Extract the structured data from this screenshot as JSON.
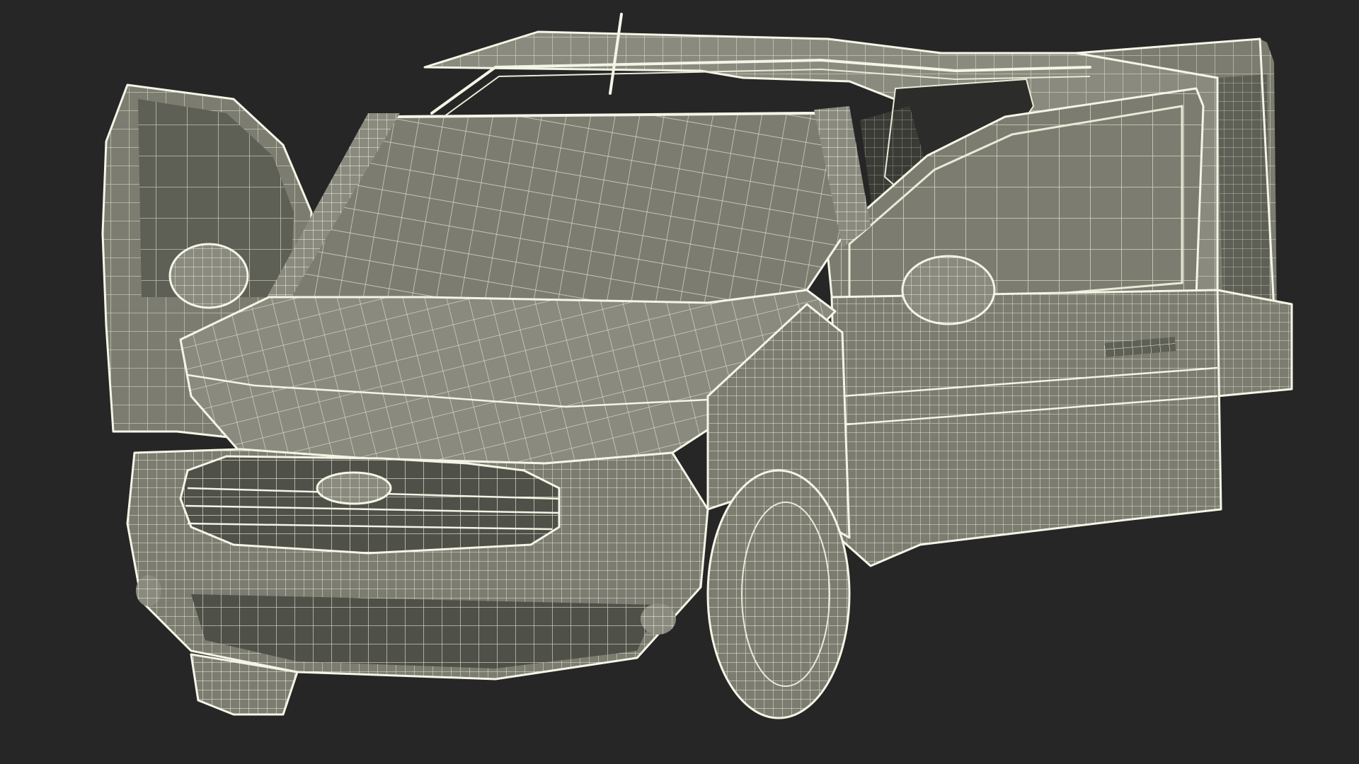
{
  "scene": {
    "subject_icon": "wireframe-van-icon",
    "background_color": "#262626",
    "surface_color": "#7c7d70",
    "surface_light_color": "#8a8b7e",
    "surface_dark_color": "#5e5f55",
    "wire_color": "#e9ebd8",
    "wire_dense_color": "#f4f5e6",
    "grille_dark_color": "#4f5048"
  }
}
